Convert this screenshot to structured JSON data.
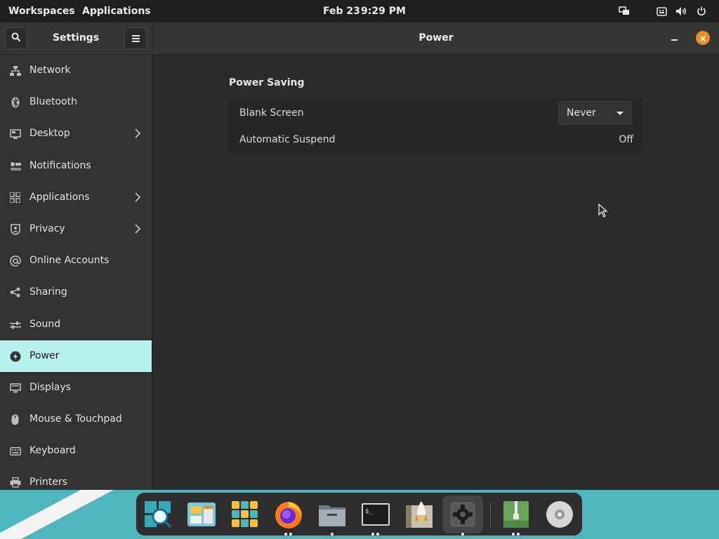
{
  "topbar": {
    "workspaces": "Workspaces",
    "applications": "Applications",
    "date": "Feb 23",
    "time": "9:29 PM",
    "tray_icons": [
      "display-switch-icon",
      "keyboard-icon",
      "volume-icon",
      "power-icon"
    ]
  },
  "sidebar": {
    "title": "Settings",
    "search_icon": "search-icon",
    "menu_icon": "hamburger-menu-icon",
    "items": [
      {
        "label": "Network",
        "icon": "network-icon",
        "has_arrow": false
      },
      {
        "label": "Bluetooth",
        "icon": "bluetooth-icon",
        "has_arrow": false
      },
      {
        "label": "Desktop",
        "icon": "desktop-icon",
        "has_arrow": true
      },
      {
        "label": "Notifications",
        "icon": "notifications-icon",
        "has_arrow": false
      },
      {
        "label": "Applications",
        "icon": "applications-grid-icon",
        "has_arrow": true
      },
      {
        "label": "Privacy",
        "icon": "privacy-icon",
        "has_arrow": true
      },
      {
        "label": "Online Accounts",
        "icon": "at-sign-icon",
        "has_arrow": false
      },
      {
        "label": "Sharing",
        "icon": "share-icon",
        "has_arrow": false
      },
      {
        "label": "Sound",
        "icon": "sound-icon",
        "has_arrow": false
      },
      {
        "label": "Power",
        "icon": "power-bolt-icon",
        "has_arrow": false,
        "active": true
      },
      {
        "label": "Displays",
        "icon": "displays-icon",
        "has_arrow": false
      },
      {
        "label": "Mouse & Touchpad",
        "icon": "mouse-icon",
        "has_arrow": false
      },
      {
        "label": "Keyboard",
        "icon": "keyboard-icon",
        "has_arrow": false
      },
      {
        "label": "Printers",
        "icon": "printer-icon",
        "has_arrow": false
      }
    ]
  },
  "content": {
    "title": "Power",
    "section_title": "Power Saving",
    "rows": [
      {
        "label": "Blank Screen",
        "value": "Never",
        "control": "dropdown"
      },
      {
        "label": "Automatic Suspend",
        "value": "Off",
        "control": "text"
      }
    ]
  },
  "dock": {
    "apps": [
      {
        "name": "search-app-icon",
        "running": 0
      },
      {
        "name": "window-manager-app-icon",
        "running": 0
      },
      {
        "name": "app-grid-icon",
        "running": 0
      },
      {
        "name": "firefox-icon",
        "running": 2
      },
      {
        "name": "file-manager-icon",
        "running": 1
      },
      {
        "name": "terminal-icon",
        "running": 2
      },
      {
        "name": "rocket-launcher-icon",
        "running": 0
      },
      {
        "name": "settings-gear-icon",
        "running": 1
      },
      {
        "name": "archive-manager-icon",
        "running": 2
      },
      {
        "name": "disc-icon",
        "running": 0
      }
    ]
  },
  "colors": {
    "accent_active": "#b8f2f0",
    "close_button": "#f08a24",
    "desktop_bg": "#4fb6c0"
  }
}
